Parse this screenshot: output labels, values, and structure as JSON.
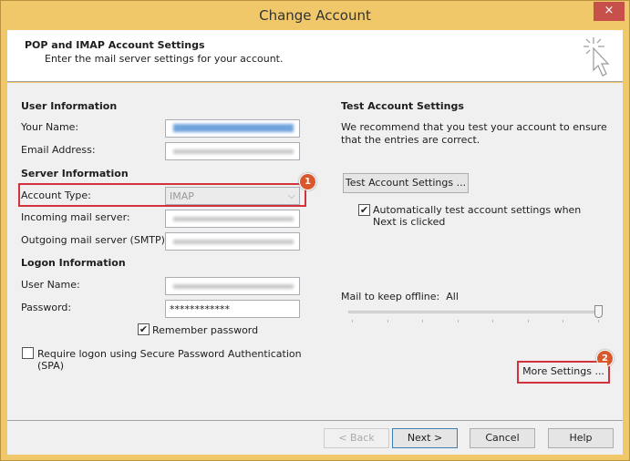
{
  "window": {
    "title": "Change Account",
    "close": "×"
  },
  "header": {
    "title": "POP and IMAP Account Settings",
    "subtitle": "Enter the mail server settings for your account.",
    "icon": "cursor-click-icon"
  },
  "user_info": {
    "heading": "User Information",
    "your_name": "Your Name:",
    "email": "Email Address:"
  },
  "server_info": {
    "heading": "Server Information",
    "account_type": "Account Type:",
    "account_type_value": "IMAP",
    "incoming": "Incoming mail server:",
    "outgoing": "Outgoing mail server (SMTP):"
  },
  "logon_info": {
    "heading": "Logon Information",
    "user_name": "User Name:",
    "password": "Password:",
    "password_value": "************",
    "remember": "Remember password",
    "remember_checked": true,
    "spa": "Require logon using Secure Password Authentication (SPA)",
    "spa_checked": false
  },
  "test": {
    "heading": "Test Account Settings",
    "description": "We recommend that you test your account to ensure that the entries are correct.",
    "button": "Test Account Settings ...",
    "auto": "Automatically test account settings when Next is clicked",
    "auto_checked": true
  },
  "offline": {
    "label": "Mail to keep offline:",
    "value": "All",
    "slider_position_percent": 100
  },
  "more_settings": "More Settings ...",
  "badges": {
    "one": "1",
    "two": "2"
  },
  "footer": {
    "back": "< Back",
    "next": "Next >",
    "cancel": "Cancel",
    "help": "Help"
  },
  "colors": {
    "frame": "#f0c86a",
    "highlight": "#d2323c",
    "badge": "#d9582b"
  }
}
